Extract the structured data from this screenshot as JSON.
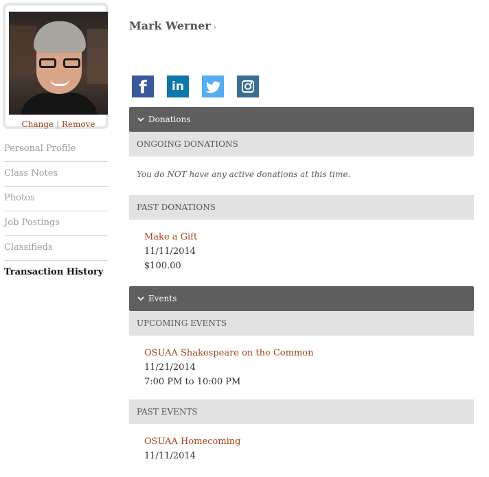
{
  "profile": {
    "name": "Mark Werner",
    "change_label": "Change",
    "separator": "|",
    "remove_label": "Remove"
  },
  "sidebar": {
    "items": [
      {
        "label": "Personal Profile",
        "active": false
      },
      {
        "label": "Class Notes",
        "active": false
      },
      {
        "label": "Photos",
        "active": false
      },
      {
        "label": "Job Postings",
        "active": false
      },
      {
        "label": "Classifieds",
        "active": false
      },
      {
        "label": "Transaction History",
        "active": true
      }
    ]
  },
  "social": {
    "icons": [
      "facebook-icon",
      "linkedin-icon",
      "twitter-icon",
      "instagram-icon"
    ],
    "colors": {
      "facebook": "#3b5998",
      "linkedin": "#0e76a8",
      "twitter": "#55acee",
      "instagram": "#3a6e93"
    }
  },
  "donations": {
    "title": "Donations",
    "ongoing_label": "ONGOING DONATIONS",
    "ongoing_note": "You do NOT have any active donations at this time.",
    "past_label": "PAST DONATIONS",
    "past": [
      {
        "title": "Make a Gift",
        "date": "11/11/2014",
        "amount": "$100.00"
      }
    ]
  },
  "events": {
    "title": "Events",
    "upcoming_label": "UPCOMING EVENTS",
    "upcoming": [
      {
        "title": "OSUAA Shakespeare on the Common",
        "date": "11/21/2014",
        "time": "7:00 PM to 10:00 PM"
      }
    ],
    "past_label": "PAST EVENTS",
    "past": [
      {
        "title": "OSUAA Homecoming",
        "date": "11/11/2014"
      }
    ]
  },
  "colors": {
    "link": "#a0421a",
    "section_bar": "#5f5f5f",
    "sub_bar": "#e2e2e2"
  }
}
